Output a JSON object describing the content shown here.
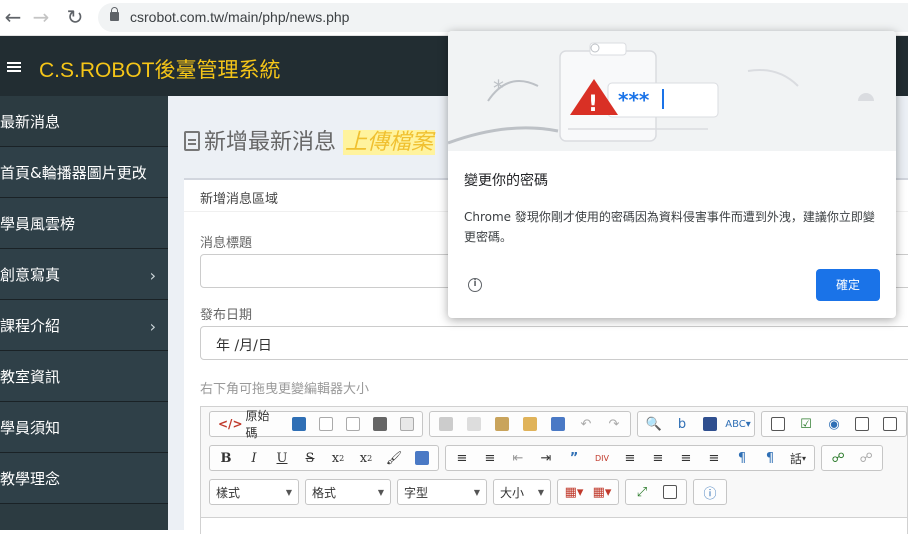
{
  "browser": {
    "url": "csrobot.com.tw/main/php/news.php"
  },
  "app": {
    "title": "C.S.ROBOT後臺管理系統",
    "header_bg": "#222d32",
    "title_color": "#f5c518"
  },
  "sidebar": {
    "items": [
      {
        "label": "最新消息",
        "has_children": false
      },
      {
        "label": "首頁&輪播器圖片更改",
        "has_children": false
      },
      {
        "label": "學員風雲榜",
        "has_children": false
      },
      {
        "label": "創意寫真",
        "has_children": true
      },
      {
        "label": "課程介紹",
        "has_children": true
      },
      {
        "label": "教室資訊",
        "has_children": false
      },
      {
        "label": "學員須知",
        "has_children": false
      },
      {
        "label": "教學理念",
        "has_children": false
      }
    ]
  },
  "main": {
    "page_title": "新增最新消息",
    "upload_label": "上傳檔案",
    "box_title": "新增消息區域",
    "fields": {
      "title_label": "消息標題",
      "title_value": "",
      "date_label": "發布日期",
      "date_value": "年 /月/日",
      "editor_hint": "右下角可拖曳更變編輯器大小"
    },
    "editor": {
      "source_label": "原始碼",
      "combos": [
        "樣式",
        "格式",
        "字型",
        "大小"
      ],
      "speech_label": "話"
    }
  },
  "popup": {
    "title": "變更你的密碼",
    "body": "Chrome 發現你剛才使用的密碼因為資料侵害事件而遭到外洩，建議你立即變更密碼。",
    "ok_label": "確定",
    "password_mask": "***",
    "accent": "#1a73e8"
  }
}
